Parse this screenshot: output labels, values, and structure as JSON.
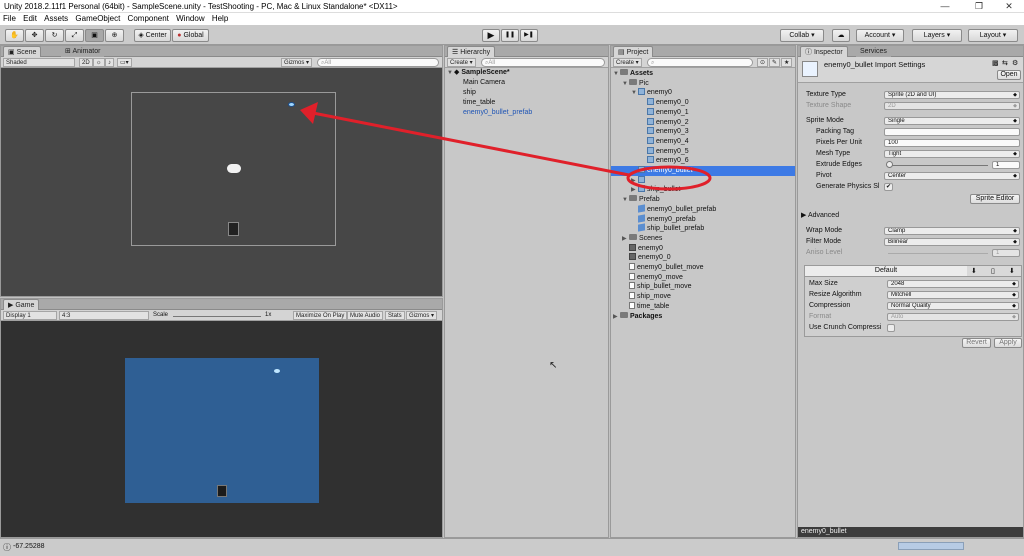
{
  "window": {
    "title": "Unity 2018.2.11f1 Personal (64bit) - SampleScene.unity - TestShooting - PC, Mac & Linux Standalone* <DX11>",
    "minimize": "—",
    "maximize": "❐",
    "close": "✕"
  },
  "menu": [
    "File",
    "Edit",
    "Assets",
    "GameObject",
    "Component",
    "Window",
    "Help"
  ],
  "toolbar": {
    "pivot_label": "Center",
    "space_label": "Global",
    "play": "▶",
    "pause": "❚❚",
    "step": "▶❚",
    "collab": "Collab ▾",
    "cloud": "☁",
    "account": "Account",
    "layers": "Layers",
    "layout": "Layout"
  },
  "scene": {
    "tab_scene": "Scene",
    "tab_animator": "Animator",
    "shading": "Shaded",
    "mode2d": "2D",
    "gizmos": "Gizmos ▾",
    "search_placeholder": "All"
  },
  "game": {
    "tab": "Game",
    "display": "Display 1",
    "aspect": "4:3",
    "scale_label": "Scale",
    "scale_value": "1x",
    "maximize": "Maximize On Play",
    "mute": "Mute Audio",
    "stats": "Stats",
    "gizmos": "Gizmos ▾"
  },
  "hierarchy": {
    "tab": "Hierarchy",
    "create": "Create ▾",
    "search_placeholder": "All",
    "scene": "SampleScene*",
    "items": [
      "Main Camera",
      "ship",
      "time_table",
      "enemy0_bullet_prefab"
    ]
  },
  "project": {
    "tab": "Project",
    "create": "Create ▾",
    "items": [
      {
        "label": "Assets",
        "icon": "folder",
        "indent": 0,
        "arrow": "▼",
        "bold": true
      },
      {
        "label": "Pic",
        "icon": "folder",
        "indent": 1,
        "arrow": "▼"
      },
      {
        "label": "enemy0",
        "icon": "sprite-sheet",
        "indent": 2,
        "arrow": "▼"
      },
      {
        "label": "enemy0_0",
        "icon": "sprite",
        "indent": 3,
        "arrow": ""
      },
      {
        "label": "enemy0_1",
        "icon": "sprite",
        "indent": 3,
        "arrow": ""
      },
      {
        "label": "enemy0_2",
        "icon": "sprite",
        "indent": 3,
        "arrow": ""
      },
      {
        "label": "enemy0_3",
        "icon": "sprite",
        "indent": 3,
        "arrow": ""
      },
      {
        "label": "enemy0_4",
        "icon": "sprite",
        "indent": 3,
        "arrow": ""
      },
      {
        "label": "enemy0_5",
        "icon": "sprite",
        "indent": 3,
        "arrow": ""
      },
      {
        "label": "enemy0_6",
        "icon": "sprite",
        "indent": 3,
        "arrow": ""
      },
      {
        "label": "enemy0_bullet",
        "icon": "sprite",
        "indent": 2,
        "arrow": "",
        "selected": true
      },
      {
        "label": "",
        "icon": "sprite",
        "indent": 2,
        "arrow": "▶"
      },
      {
        "label": "ship_bullet",
        "icon": "sprite",
        "indent": 2,
        "arrow": "▶"
      },
      {
        "label": "Prefab",
        "icon": "folder",
        "indent": 1,
        "arrow": "▼"
      },
      {
        "label": "enemy0_bullet_prefab",
        "icon": "cube",
        "indent": 2,
        "arrow": ""
      },
      {
        "label": "enemy0_prefab",
        "icon": "cube",
        "indent": 2,
        "arrow": ""
      },
      {
        "label": "ship_bullet_prefab",
        "icon": "cube",
        "indent": 2,
        "arrow": ""
      },
      {
        "label": "Scenes",
        "icon": "folder",
        "indent": 1,
        "arrow": "▶"
      },
      {
        "label": "enemy0",
        "icon": "scene",
        "indent": 1,
        "arrow": ""
      },
      {
        "label": "enemy0_0",
        "icon": "scene",
        "indent": 1,
        "arrow": ""
      },
      {
        "label": "enemy0_bullet_move",
        "icon": "script",
        "indent": 1,
        "arrow": ""
      },
      {
        "label": "enemy0_move",
        "icon": "script",
        "indent": 1,
        "arrow": ""
      },
      {
        "label": "ship_bullet_move",
        "icon": "script",
        "indent": 1,
        "arrow": ""
      },
      {
        "label": "ship_move",
        "icon": "script",
        "indent": 1,
        "arrow": ""
      },
      {
        "label": "time_table",
        "icon": "script",
        "indent": 1,
        "arrow": ""
      },
      {
        "label": "Packages",
        "icon": "folder",
        "indent": 0,
        "arrow": "▶",
        "bold": true
      }
    ]
  },
  "inspector": {
    "tab": "Inspector",
    "tab_services": "Services",
    "title": "enemy0_bullet Import Settings",
    "open": "Open",
    "texture_type": {
      "label": "Texture Type",
      "value": "Sprite (2D and UI)"
    },
    "texture_shape": {
      "label": "Texture Shape",
      "value": "2D"
    },
    "sprite_mode": {
      "label": "Sprite Mode",
      "value": "Single"
    },
    "packing_tag": {
      "label": "Packing Tag",
      "value": ""
    },
    "pixels_per_unit": {
      "label": "Pixels Per Unit",
      "value": "100"
    },
    "mesh_type": {
      "label": "Mesh Type",
      "value": "Tight"
    },
    "extrude_edges": {
      "label": "Extrude Edges",
      "value": "1"
    },
    "pivot": {
      "label": "Pivot",
      "value": "Center"
    },
    "gen_physics": {
      "label": "Generate Physics Sl",
      "checked": "✔"
    },
    "sprite_editor": "Sprite Editor",
    "advanced": "Advanced",
    "wrap_mode": {
      "label": "Wrap Mode",
      "value": "Clamp"
    },
    "filter_mode": {
      "label": "Filter Mode",
      "value": "Bilinear"
    },
    "aniso": {
      "label": "Aniso Level",
      "value": "1"
    },
    "platform_default": "Default",
    "max_size": {
      "label": "Max Size",
      "value": "2048"
    },
    "resize_algo": {
      "label": "Resize Algorithm",
      "value": "Mitchell"
    },
    "compression": {
      "label": "Compression",
      "value": "Normal Quality"
    },
    "format": {
      "label": "Format",
      "value": "Auto"
    },
    "crunch": {
      "label": "Use Crunch Compressi"
    },
    "revert": "Revert",
    "apply": "Apply",
    "preview_label": "enemy0_bullet"
  },
  "status": {
    "text": "-67.25288"
  },
  "colors": {
    "annotation_red": "#e0202a",
    "selection": "#3d7ae5",
    "game_bg": "#2f5f94"
  }
}
